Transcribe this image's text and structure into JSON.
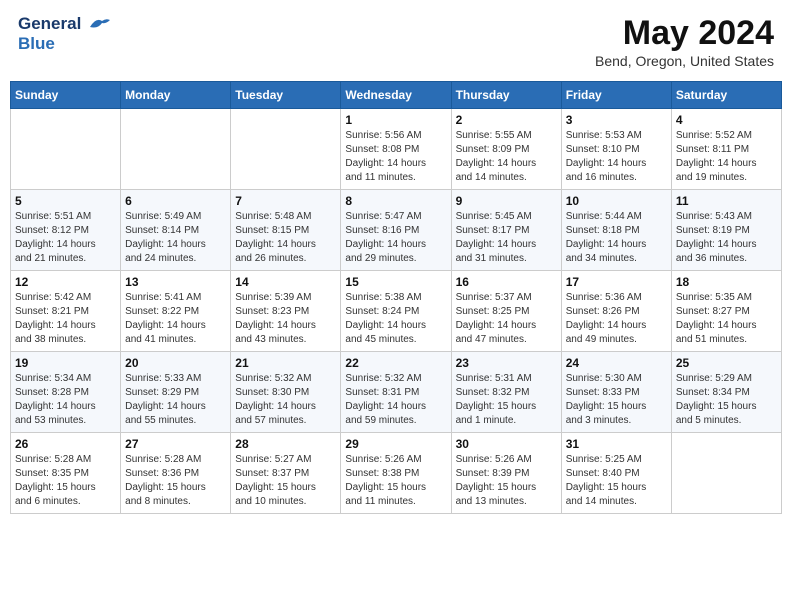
{
  "header": {
    "logo_line1": "General",
    "logo_line2": "Blue",
    "month_title": "May 2024",
    "location": "Bend, Oregon, United States"
  },
  "weekdays": [
    "Sunday",
    "Monday",
    "Tuesday",
    "Wednesday",
    "Thursday",
    "Friday",
    "Saturday"
  ],
  "weeks": [
    [
      {
        "day": "",
        "info": ""
      },
      {
        "day": "",
        "info": ""
      },
      {
        "day": "",
        "info": ""
      },
      {
        "day": "1",
        "info": "Sunrise: 5:56 AM\nSunset: 8:08 PM\nDaylight: 14 hours\nand 11 minutes."
      },
      {
        "day": "2",
        "info": "Sunrise: 5:55 AM\nSunset: 8:09 PM\nDaylight: 14 hours\nand 14 minutes."
      },
      {
        "day": "3",
        "info": "Sunrise: 5:53 AM\nSunset: 8:10 PM\nDaylight: 14 hours\nand 16 minutes."
      },
      {
        "day": "4",
        "info": "Sunrise: 5:52 AM\nSunset: 8:11 PM\nDaylight: 14 hours\nand 19 minutes."
      }
    ],
    [
      {
        "day": "5",
        "info": "Sunrise: 5:51 AM\nSunset: 8:12 PM\nDaylight: 14 hours\nand 21 minutes."
      },
      {
        "day": "6",
        "info": "Sunrise: 5:49 AM\nSunset: 8:14 PM\nDaylight: 14 hours\nand 24 minutes."
      },
      {
        "day": "7",
        "info": "Sunrise: 5:48 AM\nSunset: 8:15 PM\nDaylight: 14 hours\nand 26 minutes."
      },
      {
        "day": "8",
        "info": "Sunrise: 5:47 AM\nSunset: 8:16 PM\nDaylight: 14 hours\nand 29 minutes."
      },
      {
        "day": "9",
        "info": "Sunrise: 5:45 AM\nSunset: 8:17 PM\nDaylight: 14 hours\nand 31 minutes."
      },
      {
        "day": "10",
        "info": "Sunrise: 5:44 AM\nSunset: 8:18 PM\nDaylight: 14 hours\nand 34 minutes."
      },
      {
        "day": "11",
        "info": "Sunrise: 5:43 AM\nSunset: 8:19 PM\nDaylight: 14 hours\nand 36 minutes."
      }
    ],
    [
      {
        "day": "12",
        "info": "Sunrise: 5:42 AM\nSunset: 8:21 PM\nDaylight: 14 hours\nand 38 minutes."
      },
      {
        "day": "13",
        "info": "Sunrise: 5:41 AM\nSunset: 8:22 PM\nDaylight: 14 hours\nand 41 minutes."
      },
      {
        "day": "14",
        "info": "Sunrise: 5:39 AM\nSunset: 8:23 PM\nDaylight: 14 hours\nand 43 minutes."
      },
      {
        "day": "15",
        "info": "Sunrise: 5:38 AM\nSunset: 8:24 PM\nDaylight: 14 hours\nand 45 minutes."
      },
      {
        "day": "16",
        "info": "Sunrise: 5:37 AM\nSunset: 8:25 PM\nDaylight: 14 hours\nand 47 minutes."
      },
      {
        "day": "17",
        "info": "Sunrise: 5:36 AM\nSunset: 8:26 PM\nDaylight: 14 hours\nand 49 minutes."
      },
      {
        "day": "18",
        "info": "Sunrise: 5:35 AM\nSunset: 8:27 PM\nDaylight: 14 hours\nand 51 minutes."
      }
    ],
    [
      {
        "day": "19",
        "info": "Sunrise: 5:34 AM\nSunset: 8:28 PM\nDaylight: 14 hours\nand 53 minutes."
      },
      {
        "day": "20",
        "info": "Sunrise: 5:33 AM\nSunset: 8:29 PM\nDaylight: 14 hours\nand 55 minutes."
      },
      {
        "day": "21",
        "info": "Sunrise: 5:32 AM\nSunset: 8:30 PM\nDaylight: 14 hours\nand 57 minutes."
      },
      {
        "day": "22",
        "info": "Sunrise: 5:32 AM\nSunset: 8:31 PM\nDaylight: 14 hours\nand 59 minutes."
      },
      {
        "day": "23",
        "info": "Sunrise: 5:31 AM\nSunset: 8:32 PM\nDaylight: 15 hours\nand 1 minute."
      },
      {
        "day": "24",
        "info": "Sunrise: 5:30 AM\nSunset: 8:33 PM\nDaylight: 15 hours\nand 3 minutes."
      },
      {
        "day": "25",
        "info": "Sunrise: 5:29 AM\nSunset: 8:34 PM\nDaylight: 15 hours\nand 5 minutes."
      }
    ],
    [
      {
        "day": "26",
        "info": "Sunrise: 5:28 AM\nSunset: 8:35 PM\nDaylight: 15 hours\nand 6 minutes."
      },
      {
        "day": "27",
        "info": "Sunrise: 5:28 AM\nSunset: 8:36 PM\nDaylight: 15 hours\nand 8 minutes."
      },
      {
        "day": "28",
        "info": "Sunrise: 5:27 AM\nSunset: 8:37 PM\nDaylight: 15 hours\nand 10 minutes."
      },
      {
        "day": "29",
        "info": "Sunrise: 5:26 AM\nSunset: 8:38 PM\nDaylight: 15 hours\nand 11 minutes."
      },
      {
        "day": "30",
        "info": "Sunrise: 5:26 AM\nSunset: 8:39 PM\nDaylight: 15 hours\nand 13 minutes."
      },
      {
        "day": "31",
        "info": "Sunrise: 5:25 AM\nSunset: 8:40 PM\nDaylight: 15 hours\nand 14 minutes."
      },
      {
        "day": "",
        "info": ""
      }
    ]
  ]
}
